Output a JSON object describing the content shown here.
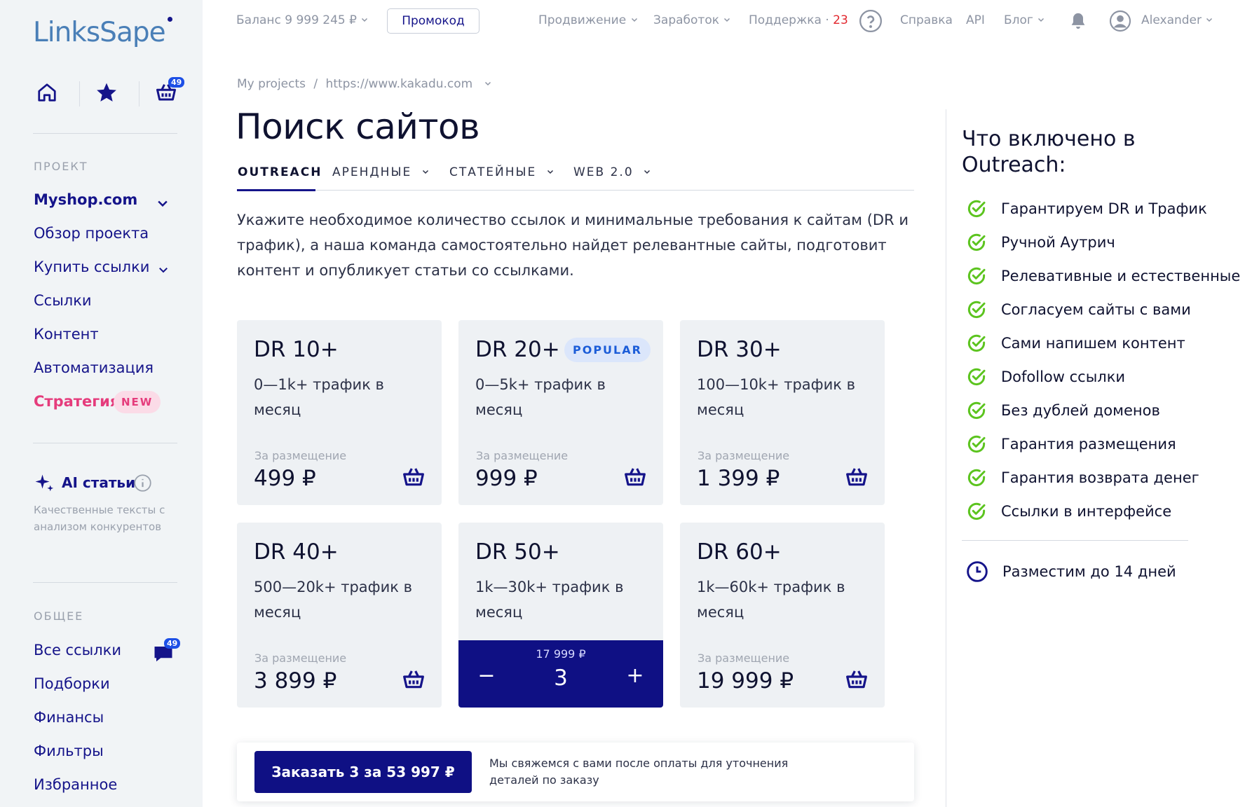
{
  "brand": {
    "name": "LinksSape"
  },
  "quick_actions": {
    "cart_count": "49"
  },
  "sidebar": {
    "project_label": "ПРОЕКТ",
    "project_items": [
      {
        "label": "Myshop.com"
      },
      {
        "label": "Обзор проекта"
      },
      {
        "label": "Купить ссылки"
      },
      {
        "label": "Ссылки"
      },
      {
        "label": "Контент"
      },
      {
        "label": "Автоматизация"
      },
      {
        "label": "Стратегия"
      }
    ],
    "new_badge": "NEW",
    "ai_title": "AI статьи",
    "ai_desc": "Качественные тексты с анализом конкурентов",
    "general_label": "ОБЩЕЕ",
    "general_items": [
      {
        "label": "Все ссылки"
      },
      {
        "label": "Подборки"
      },
      {
        "label": "Финансы"
      },
      {
        "label": "Фильтры"
      },
      {
        "label": "Избранное"
      }
    ],
    "messages_count": "49"
  },
  "topbar": {
    "balance": "Баланс 9 999 245 ₽",
    "promo": "Промокод",
    "promotion": "Продвижение",
    "earnings": "Заработок",
    "support": "Поддержка",
    "support_sep": " · ",
    "support_count": "23",
    "help": "Справка",
    "api": "API",
    "blog": "Блог",
    "user": "Alexander"
  },
  "breadcrumb": {
    "root": "My projects",
    "sep": "/",
    "project": "https://www.kakadu.com"
  },
  "page": {
    "title": "Поиск сайтов",
    "tabs": [
      {
        "label": "OUTREACH"
      },
      {
        "label": "АРЕНДНЫЕ"
      },
      {
        "label": "СТАТЕЙНЫЕ"
      },
      {
        "label": "WEB 2.0"
      }
    ],
    "intro": "Укажите необходимое количество ссылок и минимальные требования к сайтам (DR и трафик), а наша команда самостоятельно найдет релевантные сайты, подготовит контент и опубликует статьи со ссылками."
  },
  "cards": [
    {
      "dr": "DR 10+",
      "traffic": "0—1k+ трафик в месяц",
      "per": "За размещение",
      "price": "499 ₽"
    },
    {
      "dr": "DR 20+",
      "badge": "POPULAR",
      "traffic": "0—5k+ трафик в месяц",
      "per": "За размещение",
      "price": "999 ₽"
    },
    {
      "dr": "DR 30+",
      "traffic": "100—10k+ трафик в месяц",
      "per": "За размещение",
      "price": "1 399 ₽"
    },
    {
      "dr": "DR 40+",
      "traffic": "500—20k+ трафик в месяц",
      "per": "За размещение",
      "price": "3 899 ₽"
    },
    {
      "dr": "DR 50+",
      "traffic": "1k—30k+ трафик в месяц",
      "stepper_price": "17 999 ₽",
      "quantity": "3",
      "minus": "−",
      "plus": "+"
    },
    {
      "dr": "DR 60+",
      "traffic": "1k—60k+ трафик в месяц",
      "per": "За размещение",
      "price": "19 999 ₽"
    }
  ],
  "order": {
    "button": "Заказать 3 за 53 997 ₽",
    "note": "Мы свяжемся с вами после оплаты для уточнения деталей по заказу"
  },
  "right_panel": {
    "title": "Что включено в Outreach:",
    "features": [
      "Гарантируем DR и Трафик",
      "Ручной Аутрич",
      "Релевативные и естественные",
      "Согласуем сайты с вами",
      "Сами напишем контент",
      "Dofollow ссылки",
      "Без дублей доменов",
      "Гарантия размещения",
      "Гарантия возврата денег",
      "Ссылки в интерфейсе"
    ],
    "timing": "Разместим до 14 дней"
  },
  "colors": {
    "primary": "#15148a",
    "button": "#0f1084",
    "accent_pink": "#e53c7c",
    "check_green": "#5cc41f",
    "badge_blue": "#1d4fe6",
    "sidebar_bg": "#f1f4f6",
    "card_bg": "#eef1f4"
  },
  "icons": {
    "home": "home-icon",
    "favorites": "star-icon",
    "cart": "basket-icon",
    "sparkle": "sparkle-icon",
    "info": "info-icon",
    "chat": "chat-icon",
    "help": "question-icon",
    "notifications": "bell-icon",
    "user": "avatar-icon",
    "check": "check-circle-icon",
    "clock": "clock-icon",
    "chevron": "chevron-down-icon"
  }
}
